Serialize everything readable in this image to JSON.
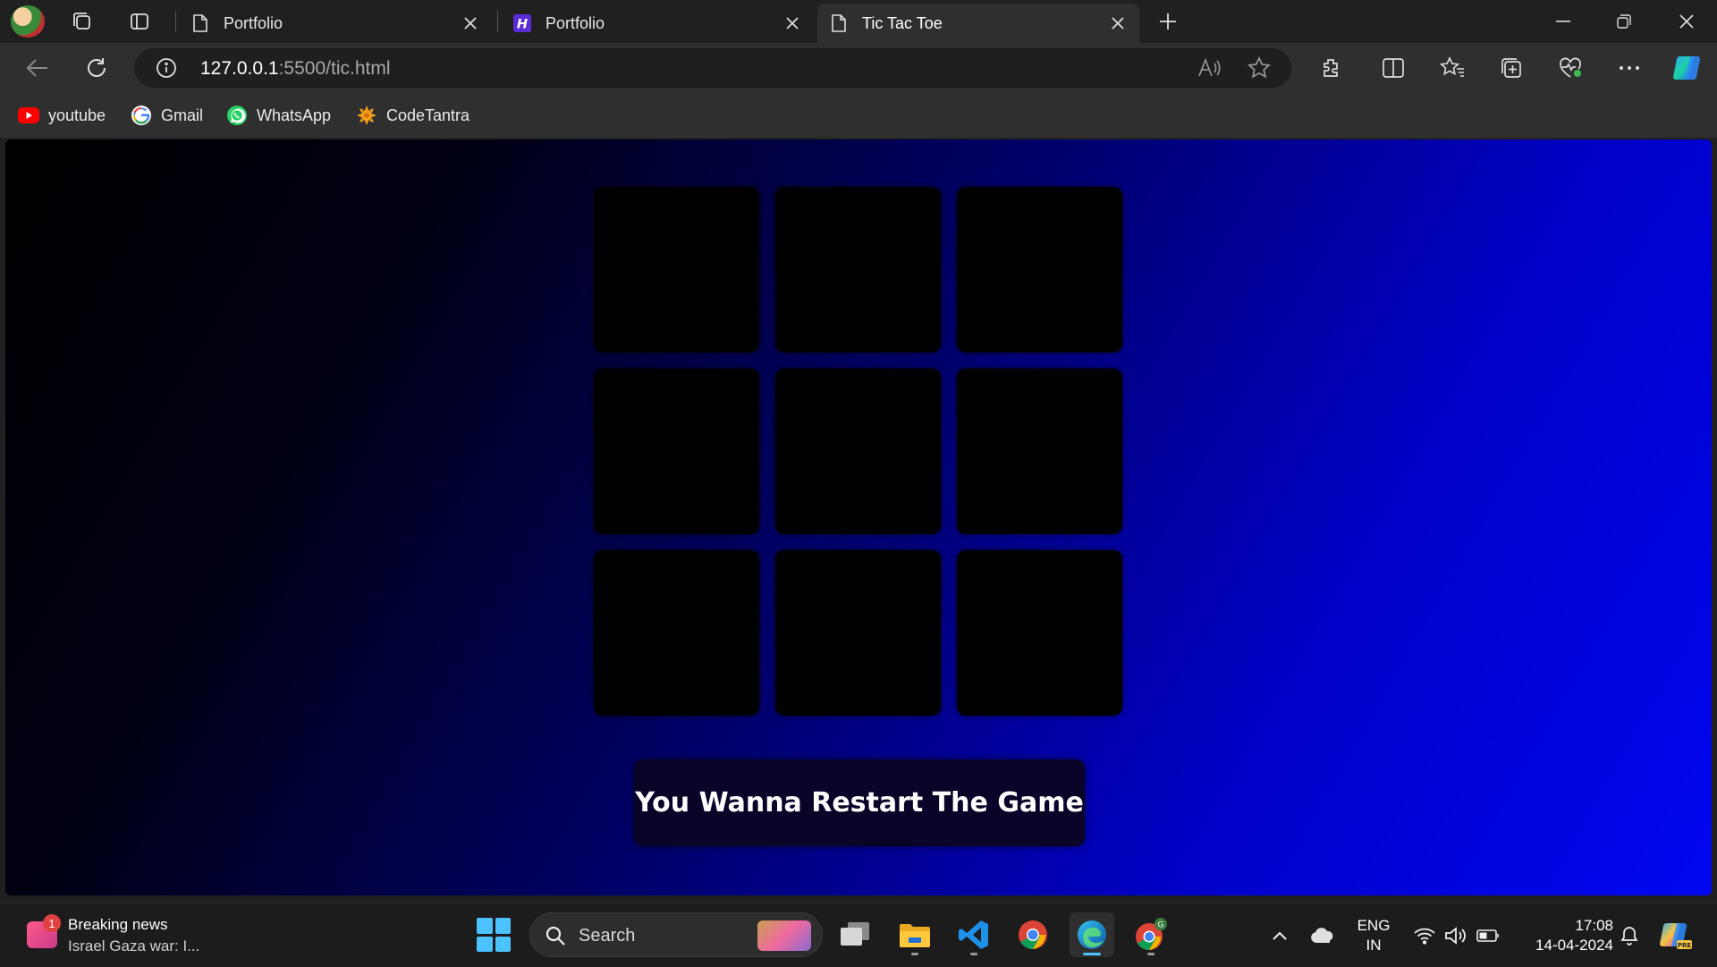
{
  "tabs": [
    {
      "title": "Portfolio",
      "favicon": "page-icon"
    },
    {
      "title": "Portfolio",
      "favicon": "h-logo-icon"
    },
    {
      "title": "Tic Tac Toe",
      "favicon": "page-icon",
      "active": true
    }
  ],
  "address": {
    "url_host": "127.0.0.1",
    "url_rest": ":5500/tic.html"
  },
  "bookmarks": [
    {
      "label": "youtube",
      "icon": "youtube-icon"
    },
    {
      "label": "Gmail",
      "icon": "google-icon"
    },
    {
      "label": "WhatsApp",
      "icon": "whatsapp-icon"
    },
    {
      "label": "CodeTantra",
      "icon": "codetantra-icon"
    }
  ],
  "game": {
    "cells": [
      "",
      "",
      "",
      "",
      "",
      "",
      "",
      "",
      ""
    ],
    "restart_label": "You Wanna Restart The Game"
  },
  "taskbar": {
    "news_badge": "1",
    "news_title": "Breaking news",
    "news_sub": "Israel Gaza war: I...",
    "search_placeholder": "Search",
    "lang_line1": "ENG",
    "lang_line2": "IN",
    "time": "17:08",
    "date": "14-04-2024"
  },
  "colors": {
    "accent": "#4cc2ff",
    "board_cell": "#000000",
    "restart_bg": "#0a0428"
  }
}
